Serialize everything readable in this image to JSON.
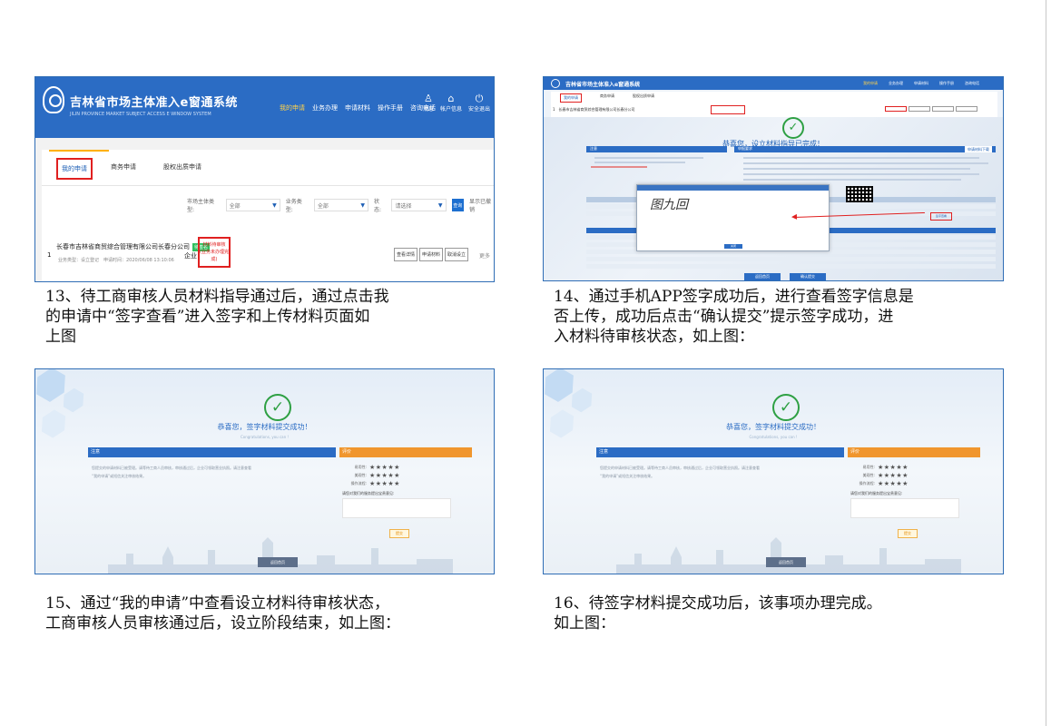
{
  "shot1": {
    "system_title": "吉林省市场主体准入e窗通系统",
    "system_subtitle": "JILIN PROVINCE MARKET SUBJECT ACCESS E WINDOW SYSTEM",
    "nav": [
      "我的申请",
      "业务办理",
      "申请材料",
      "操作手册",
      "咨询电话"
    ],
    "nav_icons": [
      {
        "glyph": "♙",
        "label": "消息"
      },
      {
        "glyph": "⌂",
        "label": "帐户信息"
      },
      {
        "glyph": "⏻",
        "label": "安全退出"
      }
    ],
    "tabs": [
      "我的申请",
      "商务申请",
      "股权出质申请"
    ],
    "filters": [
      {
        "label": "市场主体类型:",
        "value": "全部"
      },
      {
        "label": "业务类型:",
        "value": "全部"
      },
      {
        "label": "状态:",
        "value": "请选择"
      }
    ],
    "query_label": "查询",
    "show_cancelled": "显示已撤销",
    "row": {
      "index": "1",
      "company": "长春市吉林省商贸综合管理有限公司长春分公司",
      "tag": "待签名",
      "meta": "业务类型：设立登记　申请时间：2020/06/08 13:10:06",
      "type": "企业",
      "status_line1": "材料待审核",
      "status_line2": "(业务未办理完成)",
      "actions": [
        "查看详情",
        "申请材料",
        "取消设立"
      ],
      "more": "更多"
    }
  },
  "shot2": {
    "system_title": "吉林省市场主体准入e窗通系统",
    "nav": [
      "我的申请",
      "业务办理",
      "申请材料",
      "操作手册",
      "咨询电话"
    ],
    "tabs": [
      "我的申请",
      "商务申请",
      "股权出质申请"
    ],
    "row_line": "1　长春市吉林省商贸综合管理有限公司长春分公司",
    "congrats": "恭喜您，设立材料指导已完成！",
    "notice_label": "注意",
    "download_label": "申请材料下载",
    "left_bar": "申报要求",
    "signature": "图九回",
    "sign_view": "签字查看",
    "confirm_btn": "确认提交",
    "back_btn": "返回首页",
    "ok_btn": "关闭"
  },
  "shot3": {
    "title": "恭喜您，签字材料提交成功！",
    "subtitle": "Congratulations, you can !",
    "notice_label": "注意",
    "notice_line1": "您提交的申请材料已被受理。请等待工商人员审核，审核通过后，企业可领取营业执照。请注意查看",
    "notice_line2": "“我的申请”或短信关注审核结果。",
    "eval_label": "评价",
    "eval_rows": [
      {
        "label": "易用性:",
        "stars": "★★★★★"
      },
      {
        "label": "美观性:",
        "stars": "★★★★★"
      },
      {
        "label": "操作流程:",
        "stars": "★★★★★"
      }
    ],
    "eval_prompt": "请您对我们的服务提出宝贵意见:",
    "submit": "提交",
    "done": "返回首页"
  },
  "shot4": {
    "title": "恭喜您，签字材料提交成功！",
    "subtitle": "Congratulations, you can !",
    "notice_label": "注意",
    "notice_line1": "您提交的申请材料已被受理。请等待工商人员审核，审核通过后，企业可领取营业执照。请注意查看",
    "notice_line2": "“我的申请”或短信关注审核结果。",
    "eval_label": "评价",
    "eval_rows": [
      {
        "label": "易用性:",
        "stars": "★★★★★"
      },
      {
        "label": "美观性:",
        "stars": "★★★★★"
      },
      {
        "label": "操作流程:",
        "stars": "★★★★★"
      }
    ],
    "eval_prompt": "请您对我们的服务提出宝贵意见:",
    "submit": "提交",
    "done": "返回首页"
  },
  "captions": {
    "c13": [
      "13、待工商审核人员材料指导通过后，通过点击我",
      "的申请中“签字查看”进入签字和上传材料页面如",
      "上图"
    ],
    "c14": [
      "14、通过手机APP签字成功后，进行查看签字信息是",
      "否上传，成功后点击“确认提交”提示签字成功，进",
      "入材料待审核状态，如上图："
    ],
    "c15": [
      "15、通过“我的申请”中查看设立材料待审核状态，",
      "工商审核人员审核通过后，设立阶段结束，如上图："
    ],
    "c16": [
      "16、待签字材料提交成功后，该事项办理完成。",
      "如上图："
    ]
  },
  "colors": {
    "primary": "#2b6cc4",
    "highlight": "#e02020",
    "success": "#2ea043",
    "eval": "#f0962d"
  }
}
